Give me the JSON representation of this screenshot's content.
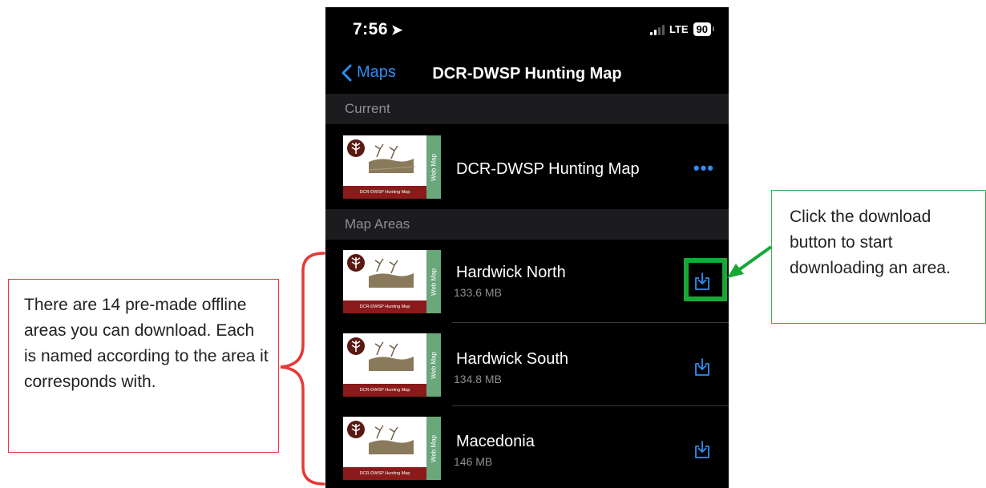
{
  "status_bar": {
    "time": "7:56",
    "network": "LTE",
    "battery": "90"
  },
  "nav": {
    "back_label": "Maps",
    "title": "DCR-DWSP Hunting Map"
  },
  "sections": {
    "current": "Current",
    "map_areas": "Map Areas"
  },
  "current_map": {
    "title": "DCR-DWSP Hunting Map",
    "more": "•••"
  },
  "thumbnail": {
    "banner": "DCR-DWSP Hunting Map",
    "strip": "Web Map"
  },
  "map_areas": [
    {
      "name": "Hardwick North",
      "size": "133.6 MB"
    },
    {
      "name": "Hardwick South",
      "size": "134.8 MB"
    },
    {
      "name": "Macedonia",
      "size": "146 MB"
    }
  ],
  "annotations": {
    "left": "There are 14 pre-made offline areas you can download. Each is named according to the area it corresponds with.",
    "right": "Click the download button to start downloading an area."
  },
  "colors": {
    "accent": "#2f8cf3",
    "highlight": "#17a837",
    "bracket": "#e53935"
  },
  "icons": [
    "location-arrow-icon",
    "chevron-left-icon",
    "more-icon",
    "download-icon"
  ]
}
